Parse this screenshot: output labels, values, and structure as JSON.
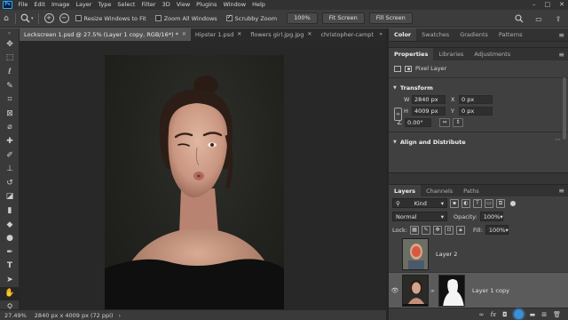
{
  "menubar": {
    "logo": "Ps",
    "items": [
      "File",
      "Edit",
      "Image",
      "Layer",
      "Type",
      "Select",
      "Filter",
      "3D",
      "View",
      "Plugins",
      "Window",
      "Help"
    ],
    "window_controls": [
      "–",
      "□",
      "✕"
    ]
  },
  "options": {
    "resize_windows_label": "Resize Windows to Fit",
    "resize_windows_checked": false,
    "zoom_all_label": "Zoom All Windows",
    "zoom_all_checked": false,
    "scrubby_zoom_label": "Scrubby Zoom",
    "scrubby_zoom_checked": true,
    "zoom_percent": "100%",
    "fit_screen": "Fit Screen",
    "fill_screen": "Fill Screen"
  },
  "tabs": [
    {
      "label": "Lockscreen 1.psd @ 27.5% (Layer 1 copy, RGB/16*) *",
      "active": true
    },
    {
      "label": "Hipster 1.psd",
      "active": false
    },
    {
      "label": "flowers girl.jpg.jpg",
      "active": false
    },
    {
      "label": "christopher-campt",
      "active": false
    }
  ],
  "status": {
    "zoom": "27.49%",
    "dims": "2840 px x 4009 px (72 ppi)"
  },
  "top_panel_tabs": [
    "Color",
    "Swatches",
    "Gradients",
    "Patterns"
  ],
  "properties": {
    "tabs": [
      "Properties",
      "Libraries",
      "Adjustments"
    ],
    "kind": "Pixel Layer",
    "transform_title": "Transform",
    "w_label": "W",
    "w_value": "2840 px",
    "x_label": "X",
    "x_value": "0 px",
    "h_label": "H",
    "h_value": "4009 px",
    "y_label": "Y",
    "y_value": "0 px",
    "angle_value": "0.00°",
    "align_title": "Align and Distribute"
  },
  "layers": {
    "tabs": [
      "Layers",
      "Channels",
      "Paths"
    ],
    "kind_filter": "Kind",
    "blend_mode": "Normal",
    "opacity_label": "Opacity:",
    "opacity_value": "100%",
    "lock_label": "Lock:",
    "fill_label": "Fill:",
    "fill_value": "100%",
    "items": [
      {
        "name": "Layer 2",
        "visible": false,
        "selected": false
      },
      {
        "name": "Layer 1 copy",
        "visible": true,
        "selected": true
      },
      {
        "name": "",
        "visible": false,
        "selected": false
      }
    ]
  },
  "icons": {
    "accent": "#31a8ff",
    "selection_blue": "#3a8fd9"
  }
}
